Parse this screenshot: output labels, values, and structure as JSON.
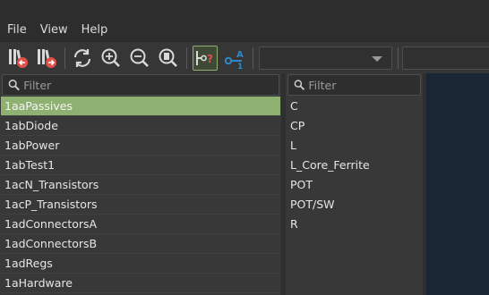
{
  "menu": {
    "items": [
      "File",
      "View",
      "Help"
    ]
  },
  "toolbar": {
    "icons": [
      "load-library-icon",
      "save-library-icon",
      "refresh-icon",
      "zoom-in-icon",
      "zoom-out-icon",
      "zoom-fit-icon",
      "show-pin-icon",
      "show-unit-icon"
    ]
  },
  "libraries": {
    "filter_placeholder": "Filter",
    "items": [
      "1aaPassives",
      "1abDiode",
      "1abPower",
      "1abTest1",
      "1acN_Transistors",
      "1acP_Transistors",
      "1adConnectorsA",
      "1adConnectorsB",
      "1adRegs",
      "1aHardware"
    ],
    "selected": "1aaPassives"
  },
  "symbols": {
    "filter_placeholder": "Filter",
    "items": [
      "C",
      "CP",
      "L",
      "L_Core_Ferrite",
      "POT",
      "POT/SW",
      "R"
    ]
  },
  "colors": {
    "selection": "#8eb070",
    "preview_bg": "#1b2634",
    "accent_icon": "#2f88c8",
    "arrow_red": "#e0504a"
  }
}
